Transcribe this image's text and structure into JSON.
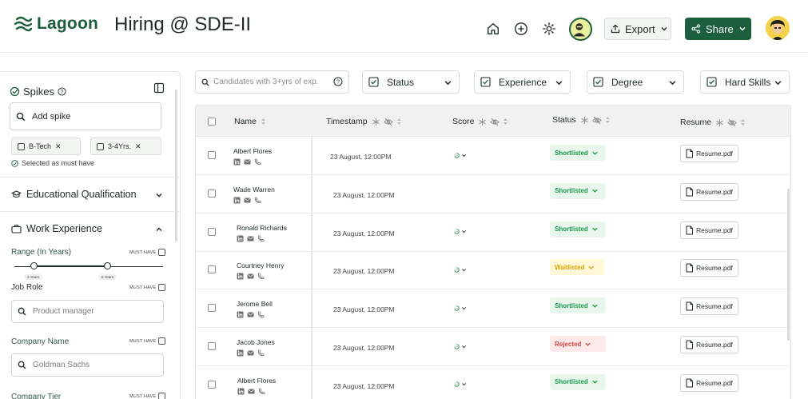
{
  "app": {
    "logo_text": "Lagoon",
    "page_title": "Hiring @ SDE-II",
    "brand_color": "#1d5e3e"
  },
  "header": {
    "icons": [
      "home-icon",
      "add-circle-icon",
      "gear-icon"
    ],
    "export_label": "Export",
    "share_label": "Share"
  },
  "sidebar": {
    "title": "Spikes",
    "spike_placeholder": "Add spike",
    "chips": [
      "B-Tech",
      "3-4Yrs."
    ],
    "must_note": "Selected as must have",
    "sections": {
      "education": "Educational Qualification",
      "experience": "Work Experience"
    },
    "range_label": "Range (In Years)",
    "range_min_label": "2 Years",
    "range_max_label": "6 Years",
    "must_have": "MUST HAVE",
    "job_role_label": "Job Role",
    "job_role_placeholder": "Product manager",
    "company_name_label": "Company Name",
    "company_name_placeholder": "Goldman Sachs",
    "company_tier_label": "Company Tier"
  },
  "filters": {
    "search_placeholder": "Candidates with 3+yrs of exp.",
    "items": [
      "Status",
      "Experience",
      "Degree",
      "Hard Skills"
    ]
  },
  "table": {
    "columns": [
      "Name",
      "Timestamp",
      "Score",
      "Status",
      "Resume"
    ],
    "rows": [
      {
        "name": "Albert Flores",
        "timestamp": "23 August, 12:00PM",
        "score": "67",
        "status": "Shortlisted",
        "resume": "Resume.pdf"
      },
      {
        "name": "Wade Warren",
        "timestamp": "23 August, 12:00PM",
        "score": "",
        "status": "Shortlisted",
        "resume": "Resume.pdf"
      },
      {
        "name": "Ronald Richards",
        "timestamp": "23 August, 12:00PM",
        "score": "67",
        "status": "Shortlisted",
        "resume": "Resume.pdf"
      },
      {
        "name": "Courtney Henry",
        "timestamp": "23 August, 12:00PM",
        "score": "67",
        "status": "Waitlisted",
        "resume": "Resume.pdf"
      },
      {
        "name": "Jerome Bell",
        "timestamp": "23 August, 12:00PM",
        "score": "67",
        "status": "Shortlisted",
        "resume": "Resume.pdf"
      },
      {
        "name": "Jacob Jones",
        "timestamp": "23 August, 12:00PM",
        "score": "67",
        "status": "Rejected",
        "resume": "Resume.pdf"
      },
      {
        "name": "Albert Flores",
        "timestamp": "23 August, 12:00PM",
        "score": "67",
        "status": "Shortlisted",
        "resume": "Resume.pdf"
      }
    ],
    "status_colors": {
      "Shortlisted": "#1a9b4b",
      "Waitlisted": "#d6a800",
      "Rejected": "#d64545"
    }
  }
}
